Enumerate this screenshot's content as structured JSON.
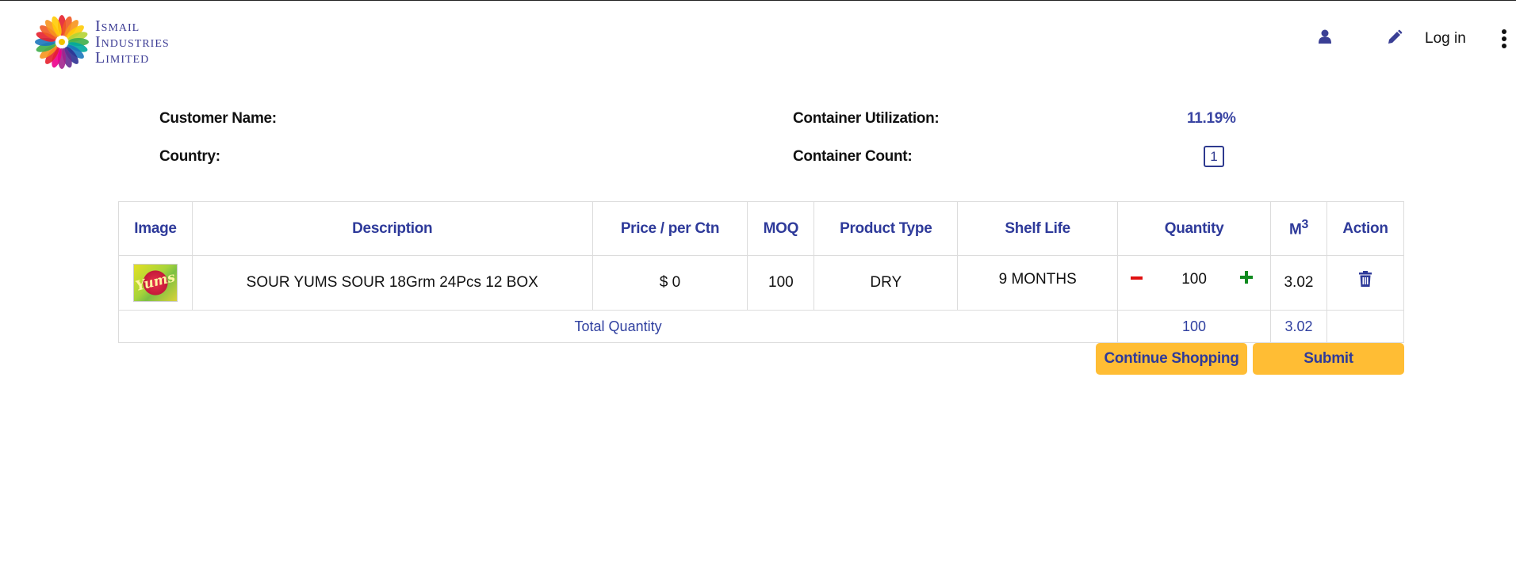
{
  "header": {
    "brand_lines": [
      "Ismail",
      "Industries",
      "Limited"
    ],
    "login_label": "Log in",
    "icons": {
      "user": "user-icon",
      "edit": "pencil-icon",
      "menu": "more-vertical-icon"
    }
  },
  "summary": {
    "customer_name_label": "Customer Name:",
    "customer_name_value": "",
    "country_label": "Country:",
    "country_value": "",
    "container_utilization_label": "Container Utilization:",
    "container_utilization_value": "11.19%",
    "container_count_label": "Container Count:",
    "container_count_value": "1"
  },
  "table": {
    "headers": {
      "image": "Image",
      "description": "Description",
      "price": "Price / per Ctn",
      "moq": "MOQ",
      "product_type": "Product Type",
      "shelf_life": "Shelf Life",
      "quantity": "Quantity",
      "m3_base": "M",
      "m3_sup": "3",
      "action": "Action"
    },
    "rows": [
      {
        "image_label": "Yums",
        "description": "SOUR YUMS SOUR 18Grm 24Pcs 12 BOX",
        "price": "$ 0",
        "moq": "100",
        "product_type": "DRY",
        "shelf_life": "9 MONTHS",
        "quantity": "100",
        "m3": "3.02"
      }
    ],
    "total": {
      "label": "Total Quantity",
      "quantity": "100",
      "m3": "3.02"
    }
  },
  "actions": {
    "continue_label": "Continue Shopping",
    "submit_label": "Submit"
  },
  "colors": {
    "accent_blue": "#2e3a9a",
    "button_yellow": "#ffbd34",
    "minus_red": "#e01010",
    "plus_green": "#0f8a1e"
  }
}
